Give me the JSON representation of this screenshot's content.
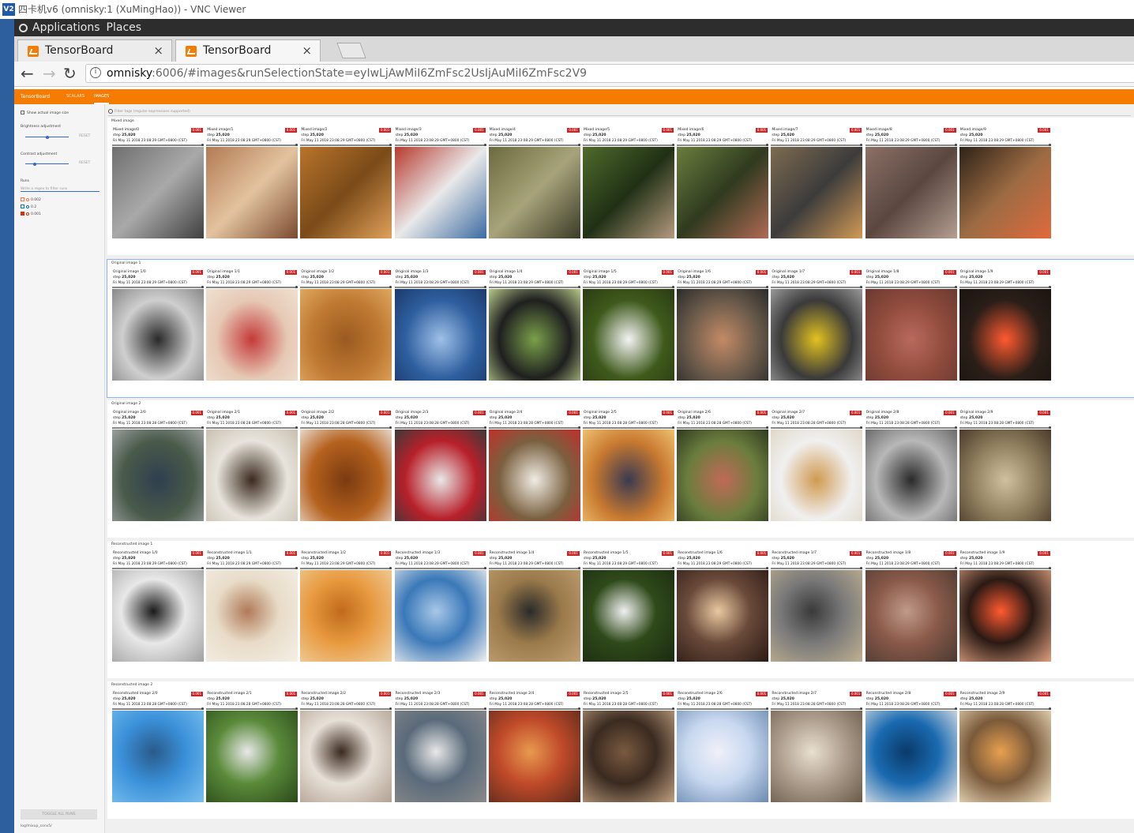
{
  "window": {
    "title": "四卡机v6 (omnisky:1 (XuMingHao)) - VNC Viewer",
    "logo": "V2"
  },
  "gnome": {
    "applications": "Applications",
    "places": "Places"
  },
  "browser": {
    "tabs": [
      {
        "label": "TensorBoard",
        "close": "×"
      },
      {
        "label": "TensorBoard",
        "close": "×"
      }
    ],
    "url_host": "omnisky",
    "url_path": ":6006/#images&runSelectionState=eyIwLjAwMiI6ZmFsc2UsIjAuMiI6ZmFsc2V9",
    "nav": {
      "back": "←",
      "forward": "→",
      "reload": "↻",
      "info": "i"
    }
  },
  "tensorboard": {
    "brand": "TensorBoard",
    "nav_tabs": [
      "SCALARS",
      "IMAGES"
    ],
    "selected_tab": "IMAGES",
    "accent_color": "#f57c00"
  },
  "sidebar": {
    "show_actual_size": "Show actual image size",
    "brightness_label": "Brightness adjustment",
    "contrast_label": "Contrast adjustment",
    "reset": "RESET",
    "brightness_value": 0.5,
    "contrast_value": 0.3,
    "runs_label": "Runs",
    "runs_filter_placeholder": "Write a regex to filter runs",
    "runs": [
      {
        "name": "0.002",
        "checked": false,
        "color": "#ff7043"
      },
      {
        "name": "0.2",
        "checked": false,
        "color": "#0077bb"
      },
      {
        "name": "0.001",
        "checked": true,
        "color": "#cc3311"
      }
    ],
    "toggle_all": "TOGGLE ALL RUNS",
    "logdir": "log/mixup_conv5/"
  },
  "main": {
    "tag_filter_placeholder": "Filter tags (regular expressions supported)",
    "run_badge": "0.001",
    "step_label": "step",
    "step_value": "25,020",
    "sections": [
      {
        "title": "Mixed image",
        "card_prefix": "Mixed image/",
        "date": "Fri May 11 2018 23:08:29 GMT+0800 (CST)"
      },
      {
        "title": "Original image 1",
        "card_prefix": "Original image 1/",
        "date": "Fri May 11 2018 23:08:29 GMT+0800 (CST)"
      },
      {
        "title": "Original image 2",
        "card_prefix": "Original image 2/",
        "date": "Fri May 11 2018 23:08:28 GMT+0800 (CST)"
      },
      {
        "title": "Reconstructed image 1",
        "card_prefix": "Reconstructed image 1/",
        "date": "Fri May 11 2018 23:08:29 GMT+0800 (CST)"
      },
      {
        "title": "Reconstructed image 2",
        "card_prefix": "Reconstructed image 2/",
        "date": "Fri May 11 2018 23:08:28 GMT+0800 (CST)"
      }
    ]
  }
}
